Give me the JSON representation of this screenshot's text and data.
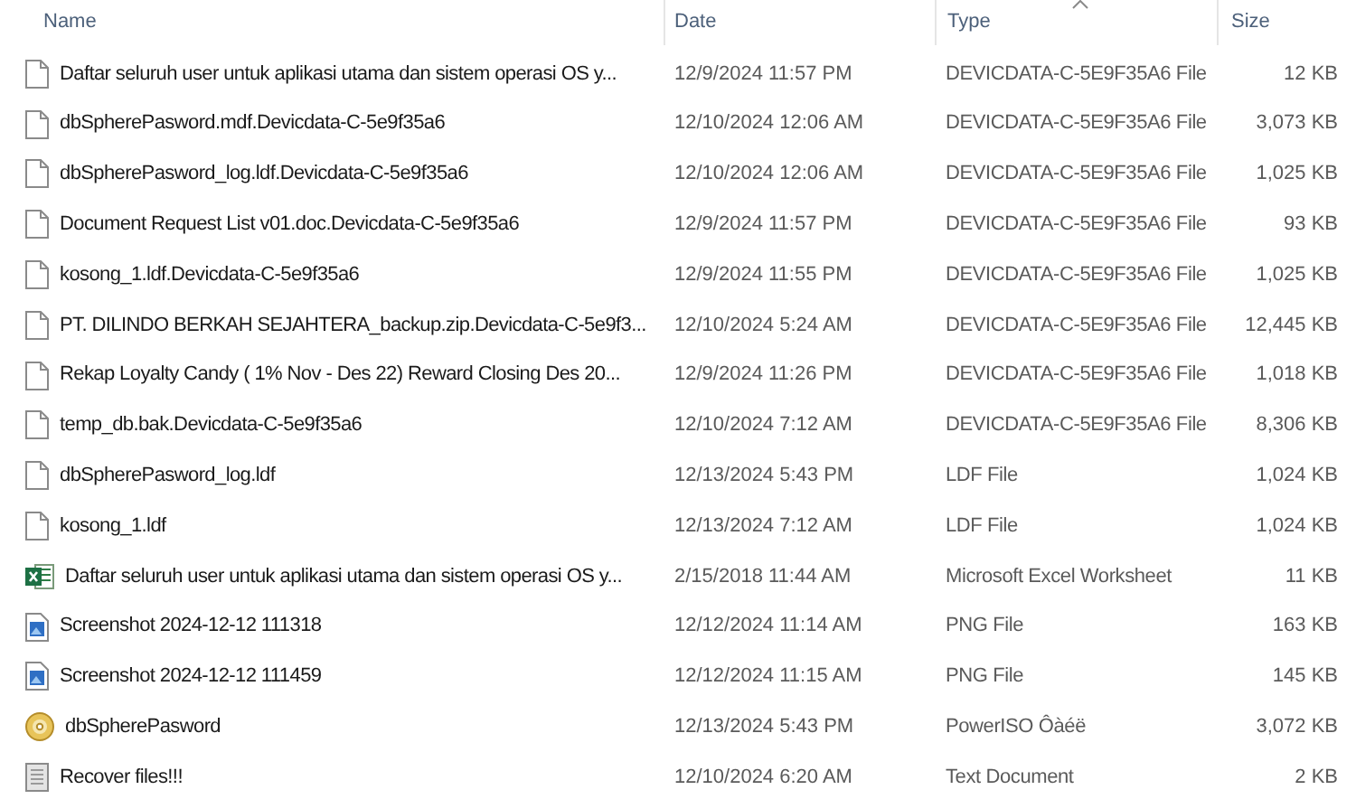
{
  "table": {
    "columns": [
      {
        "label": "Name",
        "sorted": false
      },
      {
        "label": "Date",
        "sorted": false
      },
      {
        "label": "Type",
        "sorted": true
      },
      {
        "label": "Size",
        "sorted": false
      }
    ],
    "rows": [
      {
        "kind": "blank",
        "name": "Daftar seluruh user untuk aplikasi utama dan sistem operasi OS y...",
        "date": "12/9/2024 11:57 PM",
        "type": "DEVICDATA-C-5E9F35A6 File",
        "size": "12 KB"
      },
      {
        "kind": "blank",
        "name": "dbSpherePasword.mdf.Devicdata-C-5e9f35a6",
        "date": "12/10/2024 12:06 AM",
        "type": "DEVICDATA-C-5E9F35A6 File",
        "size": "3,073 KB"
      },
      {
        "kind": "blank",
        "name": "dbSpherePasword_log.ldf.Devicdata-C-5e9f35a6",
        "date": "12/10/2024 12:06 AM",
        "type": "DEVICDATA-C-5E9F35A6 File",
        "size": "1,025 KB"
      },
      {
        "kind": "blank",
        "name": "Document Request List v01.doc.Devicdata-C-5e9f35a6",
        "date": "12/9/2024 11:57 PM",
        "type": "DEVICDATA-C-5E9F35A6 File",
        "size": "93 KB"
      },
      {
        "kind": "blank",
        "name": "kosong_1.ldf.Devicdata-C-5e9f35a6",
        "date": "12/9/2024 11:55 PM",
        "type": "DEVICDATA-C-5E9F35A6 File",
        "size": "1,025 KB"
      },
      {
        "kind": "blank",
        "name": "PT. DILINDO BERKAH SEJAHTERA_backup.zip.Devicdata-C-5e9f3...",
        "date": "12/10/2024 5:24 AM",
        "type": "DEVICDATA-C-5E9F35A6 File",
        "size": "12,445 KB"
      },
      {
        "kind": "blank",
        "name": "Rekap Loyalty Candy ( 1% Nov - Des 22) Reward Closing Des 20...",
        "date": "12/9/2024 11:26 PM",
        "type": "DEVICDATA-C-5E9F35A6 File",
        "size": "1,018 KB"
      },
      {
        "kind": "blank",
        "name": "temp_db.bak.Devicdata-C-5e9f35a6",
        "date": "12/10/2024 7:12 AM",
        "type": "DEVICDATA-C-5E9F35A6 File",
        "size": "8,306 KB"
      },
      {
        "kind": "blank",
        "name": "dbSpherePasword_log.ldf",
        "date": "12/13/2024 5:43 PM",
        "type": "LDF File",
        "size": "1,024 KB"
      },
      {
        "kind": "blank",
        "name": "kosong_1.ldf",
        "date": "12/13/2024 7:12 AM",
        "type": "LDF File",
        "size": "1,024 KB"
      },
      {
        "kind": "excel",
        "name": "Daftar seluruh user untuk aplikasi utama dan sistem operasi OS y...",
        "date": "2/15/2018 11:44 AM",
        "type": "Microsoft Excel Worksheet",
        "size": "11 KB"
      },
      {
        "kind": "image",
        "name": "Screenshot 2024-12-12 111318",
        "date": "12/12/2024 11:14 AM",
        "type": "PNG File",
        "size": "163 KB"
      },
      {
        "kind": "image",
        "name": "Screenshot 2024-12-12 111459",
        "date": "12/12/2024 11:15 AM",
        "type": "PNG File",
        "size": "145 KB"
      },
      {
        "kind": "disc",
        "name": "dbSpherePasword",
        "date": "12/13/2024 5:43 PM",
        "type": "PowerISO Ôàéë",
        "size": "3,072 KB"
      },
      {
        "kind": "text",
        "name": "Recover files!!!",
        "date": "12/10/2024 6:20 AM",
        "type": "Text Document",
        "size": "2 KB"
      }
    ]
  }
}
